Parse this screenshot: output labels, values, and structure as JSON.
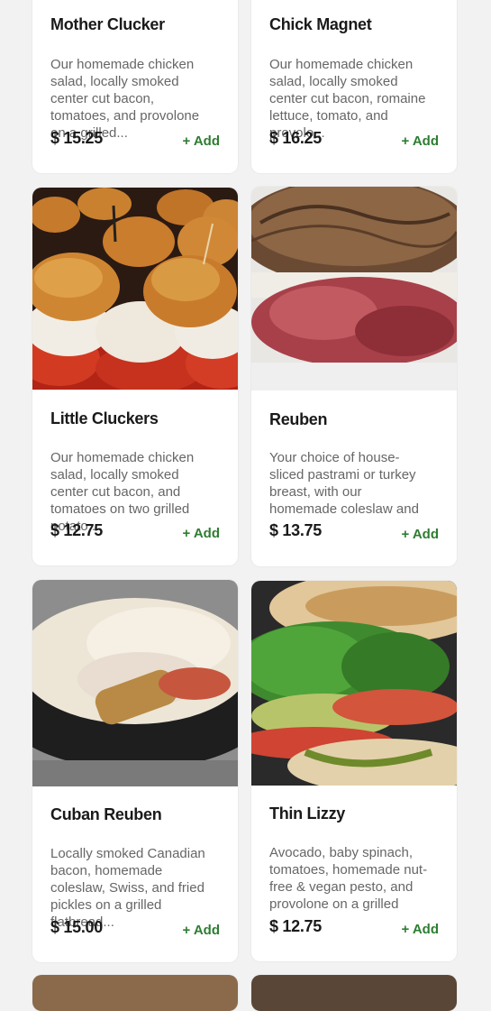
{
  "items": [
    {
      "title": "Mother Clucker",
      "description": "Our homemade chicken salad, locally smoked center cut bacon, tomatoes, and provolone on a grilled...",
      "price": "$ 15.25",
      "add_label": "+ Add"
    },
    {
      "title": "Chick Magnet",
      "description": "Our homemade chicken salad, locally smoked center cut bacon, romaine lettuce, tomato, and provolo...",
      "price": "$ 16.25",
      "add_label": "+ Add"
    },
    {
      "title": "Little Cluckers",
      "description": "Our homemade chicken salad, locally smoked center cut bacon, and tomatoes on two grilled potato...",
      "price": "$ 12.75",
      "add_label": "+ Add"
    },
    {
      "title": "Reuben",
      "description": "Your choice of house-sliced pastrami or turkey breast, with our homemade coleslaw and Swiss on gr...",
      "price": "$ 13.75",
      "add_label": "+ Add"
    },
    {
      "title": "Cuban Reuben",
      "description": "Locally smoked Canadian bacon, homemade coleslaw, Swiss, and fried pickles on a grilled flatbread...",
      "price": "$ 15.00",
      "add_label": "+ Add"
    },
    {
      "title": "Thin Lizzy",
      "description": "Avocado, baby spinach, tomatoes, homemade nut-free & vegan pesto, and provolone on a grilled flat...",
      "price": "$ 12.75",
      "add_label": "+ Add"
    }
  ],
  "colors": {
    "add": "#2e7d32",
    "background": "#f2f2f2"
  }
}
